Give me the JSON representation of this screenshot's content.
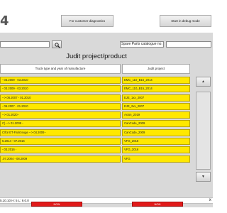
{
  "header": {
    "logo_fragment": "4",
    "buttons": [
      {
        "label": "For customer diagnostics"
      },
      {
        "label": "Start in debug mode"
      }
    ]
  },
  "search": {
    "value": "",
    "spare_parts_label": "Spare Parts catalogue no.",
    "spare_parts_value": ""
  },
  "title": "Judit project/product",
  "columns": {
    "left_header": "Truck type and year of manufacture",
    "right_header": "Judit project"
  },
  "rows": [
    {
      "truck": " - 03.2009 - 03.2010",
      "project": "EMC_110_B15_2014"
    },
    {
      "truck": " - 03.2009 - 03.2010",
      "project": "EMC_110_B15_2014"
    },
    {
      "truck": " --> 06.2007 - 01.2010",
      "project": "EJE_1xx_2007"
    },
    {
      "truck": " - 06.2007 - 01.2010",
      "project": "EJE_2xx_2007"
    },
    {
      "truck": " --> 01.2020 - ",
      "project": "Axion_2019"
    },
    {
      "truck": "C) --> 01.2009 - ",
      "project": "CanCode_2009"
    },
    {
      "truck": "C/für ET-Fahrzeuge --> 04.2009 - ",
      "project": "CanCode_2009"
    },
    {
      "truck": "5.2014 - 07.2016",
      "project": "VFG_2016"
    },
    {
      "truck": " - 03.2016 - ",
      "project": "VFG_2016"
    },
    {
      "truck": ".07.2004 - 08.2009",
      "project": "VFG"
    }
  ],
  "scroll": {
    "up": "▲",
    "down": "▼"
  },
  "status": {
    "version": "5.10.10   H: 5   L: 9.0.0",
    "exit_glyph": "x"
  },
  "footer": {
    "left_button": "NON",
    "right_button": "NON"
  },
  "colors": {
    "row_yellow": "#ffe800",
    "panel_gray": "#d9d9d9",
    "footer_red": "#e11a1a"
  },
  "icons": {
    "search": "magnifier-icon"
  }
}
